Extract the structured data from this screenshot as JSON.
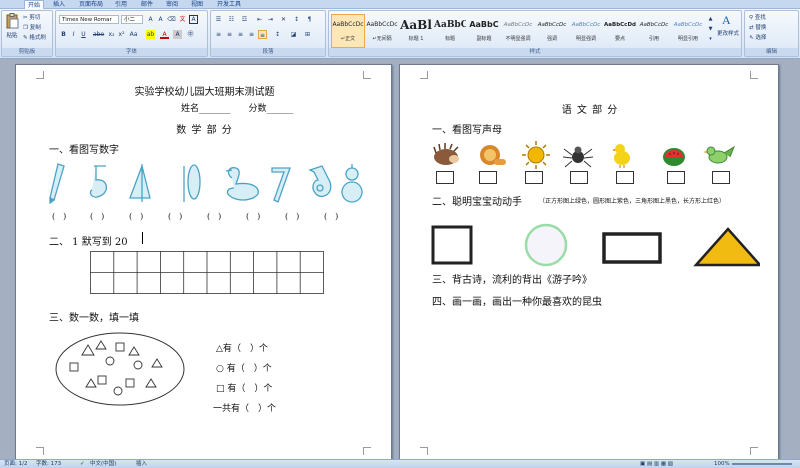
{
  "ribbon": {
    "tabs": [
      "开始",
      "插入",
      "页面布局",
      "引用",
      "邮件",
      "审阅",
      "视图",
      "开发工具"
    ],
    "active_tab": 0,
    "clipboard": {
      "paste": "粘贴",
      "cut": "剪切",
      "copy": "复制",
      "format_painter": "格式刷",
      "label": "剪贴板"
    },
    "font": {
      "name": "Times New Romar",
      "size": "小二",
      "label": "字体"
    },
    "paragraph": {
      "label": "段落"
    },
    "styles": {
      "label": "样式",
      "items": [
        {
          "preview": "AaBbCcDc",
          "name": "↵正文"
        },
        {
          "preview": "AaBbCcDc",
          "name": "↵无间隔"
        },
        {
          "preview": "AaBl",
          "name": "标题 1"
        },
        {
          "preview": "AaBbC",
          "name": "标题"
        },
        {
          "preview": "AaBbC",
          "name": "副标题"
        },
        {
          "preview": "AaBbCcDc",
          "name": "不明显强调"
        },
        {
          "preview": "AaBbCcDc",
          "name": "强调"
        },
        {
          "preview": "AaBbCcDc",
          "name": "明显强调"
        },
        {
          "preview": "AaBbCcDd",
          "name": "要点"
        },
        {
          "preview": "AaBbCcDc",
          "name": "引用"
        },
        {
          "preview": "AaBbCcDc",
          "name": "明显引用"
        }
      ],
      "change_styles": "更改样式"
    },
    "editing": {
      "label": "编辑",
      "find": "查找",
      "replace": "替换",
      "select": "选择"
    }
  },
  "left_page": {
    "title": "实验学校幼儿园大班期末测试题",
    "name_line": "姓名_______　　分数______",
    "section_title": "数 学 部 分",
    "q1": "一、看图写数字",
    "q1_blanks": [
      "(　)",
      "(　)",
      "(　)",
      "(　)",
      "(　)",
      "(　)",
      "(　)",
      "(　)"
    ],
    "q2": "二、 1 默写到 20",
    "q3": "三、数一数，填一填",
    "count_items": [
      {
        "shape": "△",
        "prefix": "有",
        "blank": "（　）",
        "unit": "个"
      },
      {
        "shape": "○",
        "prefix": "有",
        "blank": "（　）",
        "unit": "个"
      },
      {
        "shape": "□",
        "prefix": "有",
        "blank": "（　）",
        "unit": "个"
      },
      {
        "shape": "",
        "prefix": "一共有",
        "blank": "（　）",
        "unit": "个"
      }
    ]
  },
  "right_page": {
    "section_title": "语 文 部 分",
    "q1": "一、看图写声母",
    "q2": "二、聪明宝宝动动手",
    "q2_note": "（正方形图上绿色，圆形图上紫色，三角形图上黑色，长方形上红色）",
    "q3": "三、背古诗，流利的背出《游子吟》",
    "q4": "四、画一画，画出一种你最喜欢的昆虫",
    "pictures": [
      "hedgehog-icon",
      "lion-icon",
      "sun-icon",
      "spider-icon",
      "chick-icon",
      "watermelon-icon",
      "bird-icon"
    ]
  },
  "status": {
    "page": "页面: 1/2",
    "words": "字数: 173",
    "language": "中文(中国)",
    "mode": "插入",
    "zoom": "100%"
  }
}
